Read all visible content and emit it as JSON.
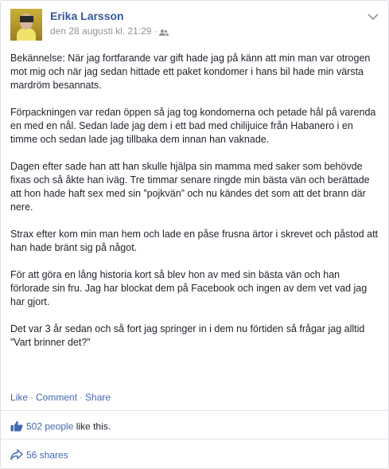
{
  "post": {
    "author": "Erika Larsson",
    "timestamp": "den 28 augusti kl. 21:29",
    "separator": "·",
    "privacy_icon": "friends-icon",
    "paragraphs": [
      "Bekännelse: När jag fortfarande var gift hade jag på känn att min man var otrogen mot mig och när jag sedan hittade ett paket kondomer i hans bil hade min värsta mardröm besannats.",
      "Förpackningen var redan öppen så jag tog kondomerna och petade hål på varenda en med en nål. Sedan lade jag dem i ett bad med chilijuice från Habanero i en timme och sedan lade jag tillbaka dem innan han vaknade.",
      "Dagen efter sade han att han skulle hjälpa sin mamma med saker som behövde fixas och så åkte han iväg. Tre timmar senare ringde min bästa vän och berättade att hon hade haft sex med sin ”pojkvän” och nu kändes det som att det brann där nere.",
      "Strax efter kom min man hem och lade en påse frusna ärtor i skrevet och påstod att han hade bränt sig på något.",
      "För att göra en lång historia kort så blev hon av med sin bästa vän och han förlorade sin fru. Jag har blockat dem på Facebook och ingen av dem vet vad jag har gjort.",
      "Det var 3 år sedan och så fort jag springer in i dem nu förtiden så frågar jag alltid ”Vart brinner det?”"
    ]
  },
  "actions": {
    "like": "Like",
    "comment": "Comment",
    "share": "Share",
    "dot": "·"
  },
  "stats": {
    "likes_link": "502 people",
    "likes_suffix": " like this.",
    "shares": "56 shares"
  },
  "colors": {
    "link": "#365899",
    "meta": "#90949c",
    "text": "#1d2129"
  }
}
